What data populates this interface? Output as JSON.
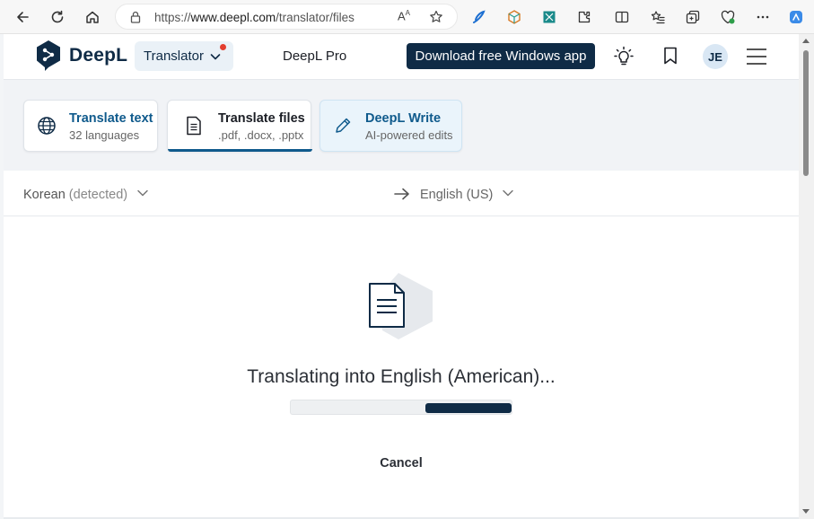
{
  "browser": {
    "url_prefix": "https://",
    "url_host": "www.deepl.com",
    "url_path": "/translator/files",
    "reader_mode_label": "A̅"
  },
  "header": {
    "logo_text": "DeepL",
    "translator_label": "Translator",
    "pro_label": "DeepL Pro",
    "download_label": "Download free Windows app",
    "avatar_initials": "JE"
  },
  "modes": {
    "text": {
      "title": "Translate text",
      "subtitle": "32 languages"
    },
    "files": {
      "title": "Translate files",
      "subtitle": ".pdf, .docx, .pptx"
    },
    "write": {
      "title": "DeepL Write",
      "subtitle": "AI-powered edits"
    }
  },
  "languages": {
    "source": "Korean",
    "source_detected": "(detected)",
    "target": "English (US)"
  },
  "translation": {
    "status": "Translating into English (American)...",
    "progress_start": 0.61,
    "progress_end": 1.0,
    "cancel_label": "Cancel"
  },
  "colors": {
    "brand_navy": "#0f2b46",
    "accent_blue": "#0f5a8c",
    "notify_red": "#e33e2f"
  }
}
